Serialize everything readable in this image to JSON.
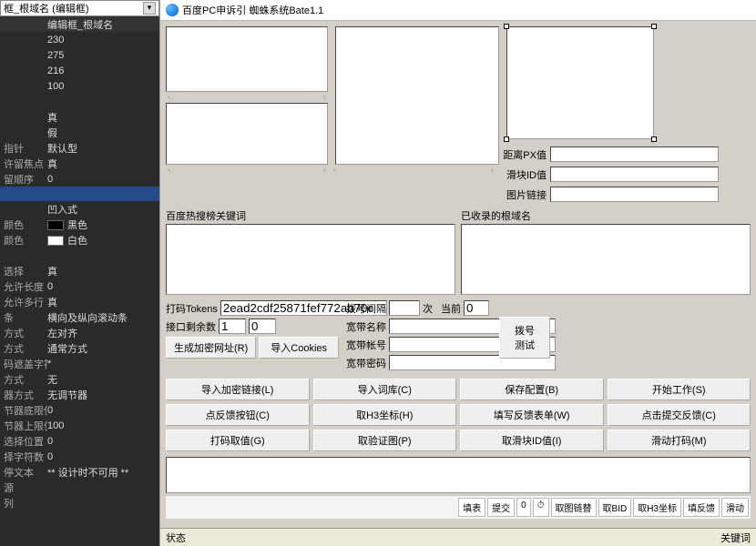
{
  "left_panel": {
    "combo": "框_根域名 (编辑框)",
    "header_left": "",
    "header_right": "编辑框_根域名",
    "props": [
      {
        "k": "",
        "v": "230"
      },
      {
        "k": "",
        "v": "275"
      },
      {
        "k": "",
        "v": "216"
      },
      {
        "k": "",
        "v": "100"
      },
      {
        "k": "",
        "v": ""
      },
      {
        "k": "",
        "v": "真"
      },
      {
        "k": "",
        "v": "假"
      },
      {
        "k": "指针",
        "v": "默认型"
      },
      {
        "k": "许留焦点",
        "v": "真"
      },
      {
        "k": "留顺序",
        "v": "0"
      },
      {
        "k": "",
        "v": "",
        "hl": true
      },
      {
        "k": "",
        "v": "凹入式"
      },
      {
        "k": "颜色",
        "v": "黑色",
        "swatch": "black"
      },
      {
        "k": "颜色",
        "v": "白色",
        "swatch": "white"
      },
      {
        "k": "",
        "v": ""
      },
      {
        "k": "选择",
        "v": "真"
      },
      {
        "k": "允许长度",
        "v": "0"
      },
      {
        "k": "允许多行",
        "v": "真"
      },
      {
        "k": "条",
        "v": "横向及纵向滚动条"
      },
      {
        "k": "方式",
        "v": "左对齐"
      },
      {
        "k": "方式",
        "v": "通常方式"
      },
      {
        "k": "码遮盖字符",
        "v": "*"
      },
      {
        "k": "方式",
        "v": "无"
      },
      {
        "k": "器方式",
        "v": "无调节器"
      },
      {
        "k": "节器底限值",
        "v": "0"
      },
      {
        "k": "节器上限值",
        "v": "100"
      },
      {
        "k": "选择位置",
        "v": "0"
      },
      {
        "k": "择字符数",
        "v": "0"
      },
      {
        "k": "停文本",
        "v": "** 设计时不可用 **"
      },
      {
        "k": "源",
        "v": ""
      },
      {
        "k": "列",
        "v": ""
      }
    ]
  },
  "app": {
    "title": "百度PC申诉引 蜘蛛系统Bate1.1",
    "px_label": "距离PX值",
    "slider_id_label": "滑块ID值",
    "img_link_label": "图片链接",
    "hot_search_label": "百度热搜榜关键词",
    "recorded_domain_label": "已收录的根域名",
    "dama_tokens_label": "打码Tokens",
    "dama_tokens_value": "2ead2cdf25871fef772ab70c",
    "api_remain_label": "接口剩余数",
    "api_remain_v1": "1",
    "api_remain_v2": "0",
    "gen_encrypt_url": "生成加密网址(R)",
    "import_cookies": "导入Cookies",
    "dial_interval_label": "拨号间隔",
    "dial_times_unit": "次",
    "current_label": "当前",
    "current_value": "0",
    "bb_name_label": "宽带名称",
    "bb_account_label": "宽带帐号",
    "bb_pwd_label": "宽带密码",
    "btn_dial_test": "拨号\n测试",
    "grid": [
      "导入加密链接(L)",
      "导入词库(C)",
      "保存配置(B)",
      "开始工作(S)",
      "点反馈按钮(C)",
      "取H3坐标(H)",
      "填写反馈表单(W)",
      "点击提交反馈(C)",
      "打码取值(G)",
      "取验证图(P)",
      "取滑块ID值(I)",
      "滑动打码(M)"
    ],
    "toolbar": [
      "填表",
      "提交",
      "0",
      "⏱",
      "取图链替",
      "取BID",
      "取H3坐标",
      "填反馈",
      "滑动"
    ],
    "status_left": "状态",
    "status_right": "关键词"
  }
}
